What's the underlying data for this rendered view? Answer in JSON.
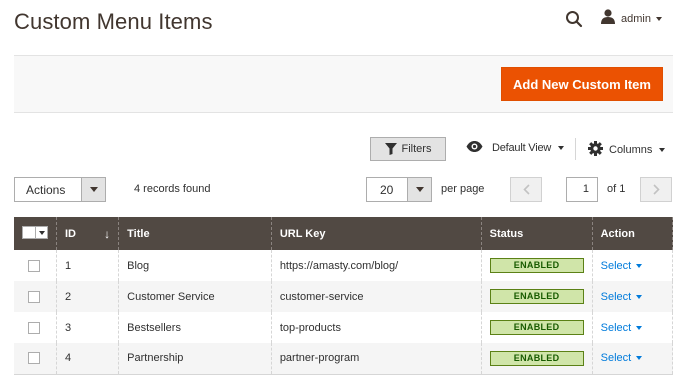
{
  "page": {
    "title": "Custom Menu Items"
  },
  "header": {
    "user": "admin",
    "search_icon": "search-icon",
    "user_icon": "user-icon"
  },
  "actions": {
    "add_new_label": "Add New Custom Item",
    "accent_color": "#eb5202"
  },
  "toolbar": {
    "filters_label": "Filters",
    "view_label": "Default View",
    "columns_label": "Columns"
  },
  "grid_controls": {
    "mass_actions_label": "Actions",
    "records_found": "4 records found",
    "per_page_value": "20",
    "per_page_label": "per page",
    "current_page": "1",
    "total_pages_label": "of 1"
  },
  "table": {
    "columns": [
      "ID",
      "Title",
      "URL Key",
      "Status",
      "Action"
    ],
    "rows": [
      {
        "id": "1",
        "title": "Blog",
        "url_key": "https://amasty.com/blog/",
        "status": "ENABLED",
        "action": "Select"
      },
      {
        "id": "2",
        "title": "Customer Service",
        "url_key": "customer-service",
        "status": "ENABLED",
        "action": "Select"
      },
      {
        "id": "3",
        "title": "Bestsellers",
        "url_key": "top-products",
        "status": "ENABLED",
        "action": "Select"
      },
      {
        "id": "4",
        "title": "Partnership",
        "url_key": "partner-program",
        "status": "ENABLED",
        "action": "Select"
      }
    ]
  },
  "colors": {
    "header_bg": "#514943",
    "link": "#007bdb",
    "status_bg": "#d0e5a9"
  }
}
